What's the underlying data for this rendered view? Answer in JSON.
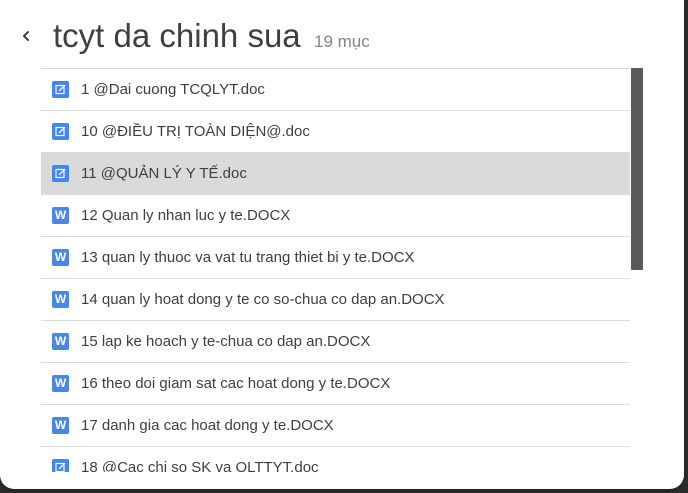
{
  "header": {
    "title": "tcyt da chinh sua",
    "count": "19 mục"
  },
  "icons": {
    "back": "chevron-left-icon",
    "doc": "google-docs-icon",
    "word": "word-doc-icon"
  },
  "colors": {
    "accent": "#4285f4",
    "selected_row": "#dadada",
    "scrollbar": "#5a5a5a"
  },
  "files": [
    {
      "name": "1 @Dai cuong TCQLYT.doc",
      "type": "doc",
      "selected": false
    },
    {
      "name": "10 @ĐIỀU TRỊ TOÀN DIỆN@.doc",
      "type": "doc",
      "selected": false
    },
    {
      "name": "11 @QUẢN LÝ Y TẾ.doc",
      "type": "doc",
      "selected": true
    },
    {
      "name": "12 Quan ly nhan luc y te.DOCX",
      "type": "word",
      "selected": false
    },
    {
      "name": "13 quan ly thuoc va vat tu trang thiet bi y te.DOCX",
      "type": "word",
      "selected": false
    },
    {
      "name": "14 quan ly hoat dong y te co so-chua co dap an.DOCX",
      "type": "word",
      "selected": false
    },
    {
      "name": "15 lap ke hoach y te-chua co dap an.DOCX",
      "type": "word",
      "selected": false
    },
    {
      "name": "16 theo doi giam sat cac hoat dong y te.DOCX",
      "type": "word",
      "selected": false
    },
    {
      "name": "17 danh gia cac hoat dong y te.DOCX",
      "type": "word",
      "selected": false
    },
    {
      "name": "18 @Cac chi so SK va QLTTYT.doc",
      "type": "doc",
      "selected": false
    }
  ]
}
